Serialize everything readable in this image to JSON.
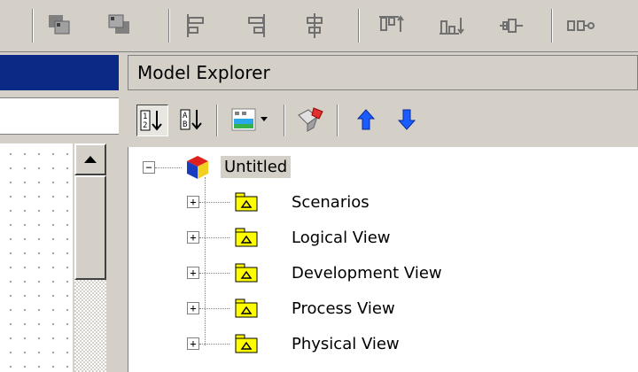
{
  "toolbar": {
    "icons": [
      "move-backward-icon",
      "bring-to-front-icon",
      "align-left-icon",
      "align-right-icon",
      "align-center-icon",
      "align-top-icon",
      "align-bottom-icon",
      "align-middle-icon",
      "distribute-horizontal-icon"
    ]
  },
  "model_explorer": {
    "title": "Model Explorer",
    "toolbar_icons": [
      "sort-numeric-icon",
      "sort-alpha-icon",
      "diagram-view-icon",
      "filter-icon",
      "move-up-icon",
      "move-down-icon"
    ],
    "tree": {
      "root": {
        "label": "Untitled",
        "expanded": true,
        "icon": "model-cube-icon"
      },
      "children": [
        {
          "label": "Scenarios",
          "expanded": false,
          "icon": "package-folder-icon"
        },
        {
          "label": "Logical View",
          "expanded": false,
          "icon": "package-folder-icon"
        },
        {
          "label": "Development View",
          "expanded": false,
          "icon": "package-folder-icon"
        },
        {
          "label": "Process View",
          "expanded": false,
          "icon": "package-folder-icon"
        },
        {
          "label": "Physical View",
          "expanded": false,
          "icon": "package-folder-icon"
        }
      ]
    }
  },
  "colors": {
    "window_bg": "#d4d0c8",
    "title_blue": "#0b2a86",
    "folder_yellow": "#ffff00",
    "arrow_blue": "#1a5cff"
  }
}
